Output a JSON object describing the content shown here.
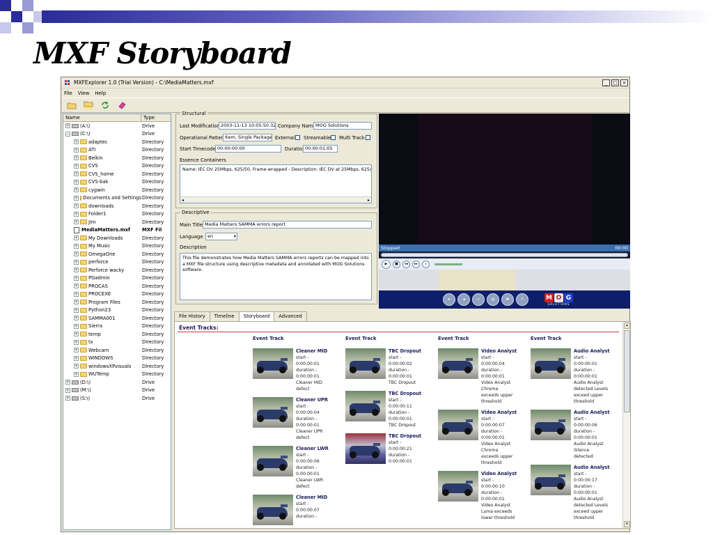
{
  "slide": {
    "title": "MXF Storyboard"
  },
  "window": {
    "title": "MXFExplorer 1.0 (Trial Version) - C:\\MediaMatters.mxf",
    "minimize": "_",
    "maximize": "□",
    "close": "×"
  },
  "menu": [
    "File",
    "View",
    "Help"
  ],
  "toolbar_icons": [
    "open-folder-icon",
    "folder-mxf-icon",
    "refresh-icon",
    "eraser-icon"
  ],
  "tree": {
    "col_name": "Name",
    "col_type": "Type",
    "rows": [
      {
        "name": "(A:\\)",
        "type": "Drive"
      },
      {
        "name": "(C:\\)",
        "type": "Drive"
      },
      {
        "name": "adaptec",
        "type": "Directory"
      },
      {
        "name": "ATI",
        "type": "Directory"
      },
      {
        "name": "Belkin",
        "type": "Directory"
      },
      {
        "name": "CVS",
        "type": "Directory"
      },
      {
        "name": "CVS_home",
        "type": "Directory"
      },
      {
        "name": "CVS-bak",
        "type": "Directory"
      },
      {
        "name": "cygwin",
        "type": "Directory"
      },
      {
        "name": "Documents and Settings",
        "type": "Directory"
      },
      {
        "name": "downloads",
        "type": "Directory"
      },
      {
        "name": "Folder1",
        "type": "Directory"
      },
      {
        "name": "Jim",
        "type": "Directory"
      },
      {
        "name": "MediaMatters.mxf",
        "type": "MXF Fil"
      },
      {
        "name": "My Downloads",
        "type": "Directory"
      },
      {
        "name": "My Music",
        "type": "Directory"
      },
      {
        "name": "OmegaOne",
        "type": "Directory"
      },
      {
        "name": "perforce",
        "type": "Directory"
      },
      {
        "name": "Perforce wacky",
        "type": "Directory"
      },
      {
        "name": "PGadmin",
        "type": "Directory"
      },
      {
        "name": "PROCAS",
        "type": "Directory"
      },
      {
        "name": "PROCEXE",
        "type": "Directory"
      },
      {
        "name": "Program Files",
        "type": "Directory"
      },
      {
        "name": "Python23",
        "type": "Directory"
      },
      {
        "name": "SAMMA001",
        "type": "Directory"
      },
      {
        "name": "Sierra",
        "type": "Directory"
      },
      {
        "name": "temp",
        "type": "Directory"
      },
      {
        "name": "tx",
        "type": "Directory"
      },
      {
        "name": "Webcam",
        "type": "Directory"
      },
      {
        "name": "WINDOWS",
        "type": "Directory"
      },
      {
        "name": "windowsXPvisuals",
        "type": "Directory"
      },
      {
        "name": "WUTemp",
        "type": "Directory"
      },
      {
        "name": "(D:\\)",
        "type": "Drive"
      },
      {
        "name": "(M:\\)",
        "type": "Drive"
      },
      {
        "name": "(S:\\)",
        "type": "Drive"
      }
    ]
  },
  "structural": {
    "legend": "Structural",
    "last_mod_label": "Last Modification",
    "last_mod_value": "2003-11-13 10:05:50.328",
    "company_label": "Company Name",
    "company_value": "MOG Solutions",
    "op_pattern_label": "Operational Pattern",
    "op_pattern_value": "Item, Single Package",
    "external_label": "External",
    "streamable_label": "Streamable",
    "multitrack_label": "Multi Track",
    "start_tc_label": "Start Timecode",
    "start_tc_value": "00:00:00:00",
    "duration_label": "Duration",
    "duration_value": "00:00:01:05",
    "essence_label": "Essence Containers",
    "essence_value": "Name: IEC DV 25Mbps, 625/50, Frame-wrapped - Description: IEC DV at 25Mbps, 625/50"
  },
  "descriptive": {
    "legend": "Descriptive",
    "main_title_label": "Main Title",
    "main_title_value": "Media Matters SAMMA errors report",
    "language_label": "Language",
    "language_value": "en",
    "description_label": "Description",
    "description_value": "This file demonstrates how Media Matters SAMMA errors reports can be mapped into a MXF file structure using descriptive metadata and annotated with MOG Solutions software."
  },
  "player": {
    "status": "Stopped",
    "time": "00:00",
    "logo": [
      "M",
      "O",
      "G"
    ],
    "logo_sub": "SOLUTIONS"
  },
  "tabs": [
    "File History",
    "Timeline",
    "Storyboard",
    "Advanced"
  ],
  "storyboard": {
    "heading": "Event Tracks:",
    "columns": [
      {
        "title": "Event Track",
        "events": [
          {
            "name": "Cleaner MID",
            "lines": [
              "start -",
              "0:00:00:01",
              "duration -",
              "0:00:00:01",
              "Cleaner MID",
              "defect"
            ]
          },
          {
            "name": "Cleaner UPR",
            "lines": [
              "start -",
              "0:00:00:04",
              "duration -",
              "0:00:00:01",
              "Cleaner UPR",
              "defect"
            ]
          },
          {
            "name": "Cleaner LWR",
            "lines": [
              "start -",
              "0:00:00:06",
              "duration -",
              "0:00:00:01",
              "Cleaner LWR",
              "defect"
            ]
          },
          {
            "name": "Cleaner MID",
            "lines": [
              "start -",
              "0:00:00:07",
              "duration -"
            ]
          }
        ]
      },
      {
        "title": "Event Track",
        "events": [
          {
            "name": "TBC Dropout",
            "lines": [
              "start -",
              "0:00:00:02",
              "duration -",
              "0:00:00:01",
              "TBC Dropout"
            ]
          },
          {
            "name": "TBC Dropout",
            "lines": [
              "start -",
              "0:00:00:11",
              "duration -",
              "0:00:00:01",
              "TBC Dropout"
            ]
          },
          {
            "name": "TBC Dropout",
            "lines": [
              "start -",
              "0:00:00:21",
              "duration -",
              "0:00:00:01"
            ]
          }
        ]
      },
      {
        "title": "Event Track",
        "events": [
          {
            "name": "Video Analyst",
            "lines": [
              "start -",
              "0:00:00:04",
              "duration -",
              "0:00:00:01",
              "Video Analyst",
              "Chroma",
              "exceeds upper",
              "threshold"
            ]
          },
          {
            "name": "Video Analyst",
            "lines": [
              "start -",
              "0:00:00:07",
              "duration -",
              "0:00:00:01",
              "Video Analyst",
              "Chroma",
              "exceeds upper",
              "threshold"
            ]
          },
          {
            "name": "Video Analyst",
            "lines": [
              "start -",
              "0:00:00:10",
              "duration -",
              "0:00:00:01",
              "Video Analyst",
              "Luma exceeds",
              "lower threshold"
            ]
          }
        ]
      },
      {
        "title": "Event Track",
        "events": [
          {
            "name": "Audio Analyst",
            "lines": [
              "start -",
              "0:00:00:01",
              "duration -",
              "0:00:00:01",
              "Audio Analyst",
              "detected Levels",
              "exceed upper",
              "threshold"
            ]
          },
          {
            "name": "Audio Analyst",
            "lines": [
              "start -",
              "0:00:00:06",
              "duration -",
              "0:00:00:01",
              "Audio Analyst",
              "Silence",
              "detected"
            ]
          },
          {
            "name": "Audio Analyst",
            "lines": [
              "start -",
              "0:00:00:17",
              "duration -",
              "0:00:00:01",
              "Audio Analyst",
              "detected Levels",
              "exceed upper",
              "threshold"
            ]
          }
        ]
      }
    ]
  }
}
